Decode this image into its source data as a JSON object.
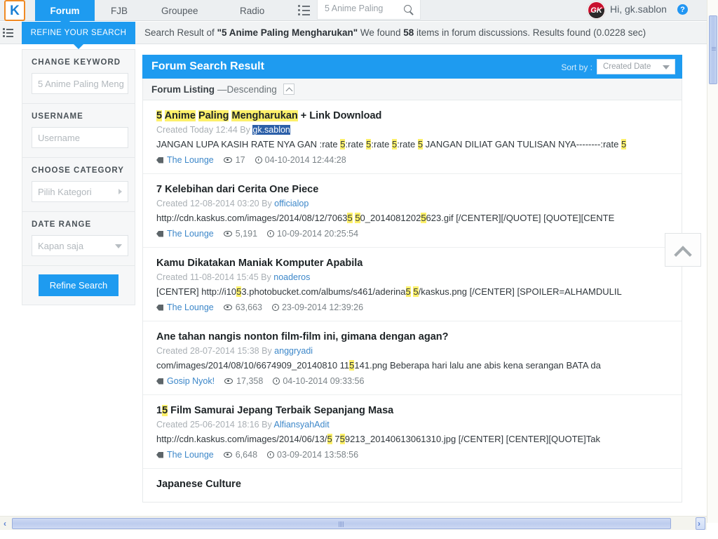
{
  "topnav": {
    "logo_text": "K",
    "logo_icon": "kaskus-logo-icon",
    "tabs": [
      {
        "label": "Forum",
        "active": true
      },
      {
        "label": "FJB",
        "active": false
      },
      {
        "label": "Groupee",
        "active": false
      },
      {
        "label": "Radio",
        "active": false
      }
    ],
    "list_icon": "list-icon",
    "search": {
      "value": "5 Anime Paling",
      "placeholder": "5 Anime Paling",
      "icon": "search-icon"
    },
    "avatar_text": "GK",
    "greeting": "Hi, gk.sablon",
    "help_icon_label": "?",
    "accent_color": "#1e9bf0",
    "logo_border_color": "#f08a24"
  },
  "subbar": {
    "menu_icon": "hamburger-icon",
    "refine_tab_label": "REFINE YOUR SEARCH",
    "result_prefix": "Search Result of ",
    "query_quoted": "\"5 Anime Paling Mengharukan\"",
    "found_mid": " We found ",
    "count": "58",
    "found_suffix": " items in forum discussions. Results found (0.0228 sec)"
  },
  "sidebar": {
    "groups": [
      {
        "label": "CHANGE KEYWORD",
        "field_value": "5 Anime Paling Meng",
        "placeholder": "5 Anime Paling Meng",
        "control": "text",
        "name": "change-keyword"
      },
      {
        "label": "USERNAME",
        "field_value": "Username",
        "placeholder": "Username",
        "control": "text",
        "name": "username"
      },
      {
        "label": "CHOOSE CATEGORY",
        "field_value": "Pilih Kategori",
        "placeholder": "Pilih Kategori",
        "control": "caret-right",
        "name": "choose-category"
      },
      {
        "label": "DATE RANGE",
        "field_value": "Kapan saja",
        "placeholder": "Kapan saja",
        "control": "caret-down",
        "name": "date-range"
      }
    ],
    "refine_button": "Refine Search"
  },
  "main": {
    "panel_title": "Forum Search Result",
    "sortby_label": "Sort by :",
    "sortby_value": "Created Date",
    "listing_label": "Forum Listing",
    "listing_dash": " — ",
    "listing_order": "Descending",
    "sort_toggle_icon": "chevron-up-icon",
    "results": [
      {
        "title_parts": [
          {
            "t": "5",
            "hl": true
          },
          {
            "t": " ",
            "hl": false
          },
          {
            "t": "Anime",
            "hl": true
          },
          {
            "t": " ",
            "hl": false
          },
          {
            "t": "Paling",
            "hl": true
          },
          {
            "t": " ",
            "hl": false
          },
          {
            "t": "Mengharukan",
            "hl": true
          },
          {
            "t": " + Link Download",
            "hl": false
          }
        ],
        "created": "Created Today 12:44 By ",
        "author": "gk.sablon",
        "author_selected": true,
        "snippet_parts": [
          {
            "t": "JANGAN LUPA KASIH RATE NYA GAN :rate ",
            "hl": false
          },
          {
            "t": "5",
            "hl": true
          },
          {
            "t": ":rate ",
            "hl": false
          },
          {
            "t": "5",
            "hl": true
          },
          {
            "t": ":rate ",
            "hl": false
          },
          {
            "t": "5",
            "hl": true
          },
          {
            "t": ":rate ",
            "hl": false
          },
          {
            "t": "5",
            "hl": true
          },
          {
            "t": " JANGAN DILIAT GAN TULISAN NYA--------:rate ",
            "hl": false
          },
          {
            "t": "5",
            "hl": true
          }
        ],
        "category": "The Lounge",
        "views": "17",
        "date": "04-10-2014 12:44:28"
      },
      {
        "title_parts": [
          {
            "t": "7 Kelebihan dari Cerita One Piece",
            "hl": false
          }
        ],
        "created": "Created 12-08-2014 03:20 By ",
        "author": "officialop",
        "author_selected": false,
        "snippet_parts": [
          {
            "t": "http://cdn.kaskus.com/images/2014/08/12/7063",
            "hl": false
          },
          {
            "t": "5",
            "hl": true
          },
          {
            "t": " ",
            "hl": false
          },
          {
            "t": "5",
            "hl": true
          },
          {
            "t": "0_2014081202",
            "hl": false
          },
          {
            "t": "5",
            "hl": true
          },
          {
            "t": "623.gif [/CENTER][/QUOTE] [QUOTE][CENTE",
            "hl": false
          }
        ],
        "category": "The Lounge",
        "views": "5,191",
        "date": "10-09-2014 20:25:54"
      },
      {
        "title_parts": [
          {
            "t": "Kamu Dikatakan Maniak Komputer Apabila",
            "hl": false
          }
        ],
        "created": "Created 11-08-2014 15:45 By ",
        "author": "noaderos",
        "author_selected": false,
        "snippet_parts": [
          {
            "t": "[CENTER] http://i10",
            "hl": false
          },
          {
            "t": "5",
            "hl": true
          },
          {
            "t": "3.photobucket.com/albums/s461/aderina",
            "hl": false
          },
          {
            "t": "5",
            "hl": true
          },
          {
            "t": " ",
            "hl": false
          },
          {
            "t": "5",
            "hl": true
          },
          {
            "t": "/kaskus.png [/CENTER] [SPOILER=ALHAMDULIL",
            "hl": false
          }
        ],
        "category": "The Lounge",
        "views": "63,663",
        "date": "23-09-2014 12:39:26"
      },
      {
        "title_parts": [
          {
            "t": "Ane tahan nangis nonton film-film ini, gimana dengan agan?",
            "hl": false
          }
        ],
        "created": "Created 28-07-2014 15:38 By ",
        "author": "anggryadi",
        "author_selected": false,
        "snippet_parts": [
          {
            "t": "com/images/2014/08/10/6674909_20140810 11",
            "hl": false
          },
          {
            "t": "5",
            "hl": true
          },
          {
            "t": "141.png Beberapa hari lalu ane abis kena serangan BATA da",
            "hl": false
          }
        ],
        "category": "Gosip Nyok!",
        "views": "17,358",
        "date": "04-10-2014 09:33:56"
      },
      {
        "title_parts": [
          {
            "t": "1",
            "hl": false
          },
          {
            "t": "5",
            "hl": true
          },
          {
            "t": " Film Samurai Jepang Terbaik Sepanjang Masa",
            "hl": false
          }
        ],
        "created": "Created 25-06-2014 18:16 By ",
        "author": "AlfiansyahAdit",
        "author_selected": false,
        "snippet_parts": [
          {
            "t": "http://cdn.kaskus.com/images/2014/06/13/",
            "hl": false
          },
          {
            "t": "5",
            "hl": true
          },
          {
            "t": " 7",
            "hl": false
          },
          {
            "t": "5",
            "hl": true
          },
          {
            "t": "9213_20140613061310.jpg [/CENTER] [CENTER][QUOTE]Tak",
            "hl": false
          }
        ],
        "category": "The Lounge",
        "views": "6,648",
        "date": "03-09-2014 13:58:56"
      },
      {
        "title_parts": [
          {
            "t": "Japanese Culture",
            "hl": false
          }
        ],
        "created": "",
        "author": "",
        "author_selected": false,
        "snippet_parts": [],
        "category": "",
        "views": "",
        "date": ""
      }
    ]
  },
  "backtotop_icon": "chevron-up-icon",
  "scrollbars": {
    "vertical_icon": "vertical-scrollbar",
    "horizontal_icon": "horizontal-scrollbar",
    "left_arrow": "‹",
    "right_arrow": "›"
  }
}
